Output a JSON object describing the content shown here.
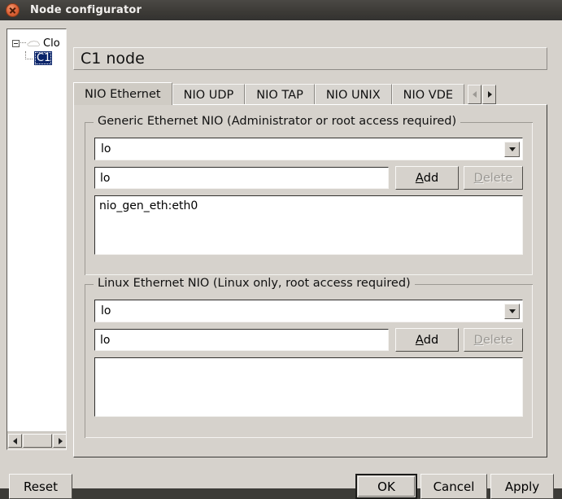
{
  "window": {
    "title": "Node configurator",
    "close_icon": "close-icon"
  },
  "tree": {
    "root": {
      "label": "Clo",
      "icon": "cloud-icon",
      "expander": "collapse-expander-icon"
    },
    "child": {
      "label": "C1",
      "selected": true
    },
    "scrollbar": {
      "left_arrow": "arrow-left-icon",
      "right_arrow": "arrow-right-icon"
    }
  },
  "header": {
    "node_title": "C1 node"
  },
  "tabs": {
    "items": [
      {
        "label": "NIO Ethernet",
        "active": true
      },
      {
        "label": "NIO UDP",
        "active": false
      },
      {
        "label": "NIO TAP",
        "active": false
      },
      {
        "label": "NIO UNIX",
        "active": false
      },
      {
        "label": "NIO VDE",
        "active": false
      }
    ],
    "scroll_left_icon": "arrow-left-icon",
    "scroll_right_icon": "arrow-right-icon",
    "scroll_left_enabled": false,
    "scroll_right_enabled": true
  },
  "generic_group": {
    "title": "Generic Ethernet NIO (Administrator or root access required)",
    "combo_value": "lo",
    "combo_arrow_icon": "chevron-down-icon",
    "input_value": "lo",
    "input_placeholder": "",
    "add_label": "Add",
    "add_accel": "A",
    "delete_label": "Delete",
    "delete_accel": "D",
    "delete_enabled": false,
    "list_items": [
      "nio_gen_eth:eth0"
    ]
  },
  "linux_group": {
    "title": "Linux Ethernet NIO (Linux only, root access required)",
    "combo_value": "lo",
    "combo_arrow_icon": "chevron-down-icon",
    "input_value": "lo",
    "input_placeholder": "",
    "add_label": "Add",
    "add_accel": "A",
    "delete_label": "Delete",
    "delete_accel": "D",
    "delete_enabled": false,
    "list_items": []
  },
  "footer": {
    "reset_label": "Reset",
    "ok_label": "OK",
    "cancel_label": "Cancel",
    "apply_label": "Apply"
  },
  "colors": {
    "window_bg": "#d6d2cc",
    "titlebar_bg": "#3c3a36",
    "titlebar_text": "#f2f0ee",
    "close_button": "#e0663c",
    "selection_bg": "#0a246a",
    "selection_text": "#ffffff",
    "field_bg": "#ffffff",
    "disabled_text": "#9a9792"
  }
}
